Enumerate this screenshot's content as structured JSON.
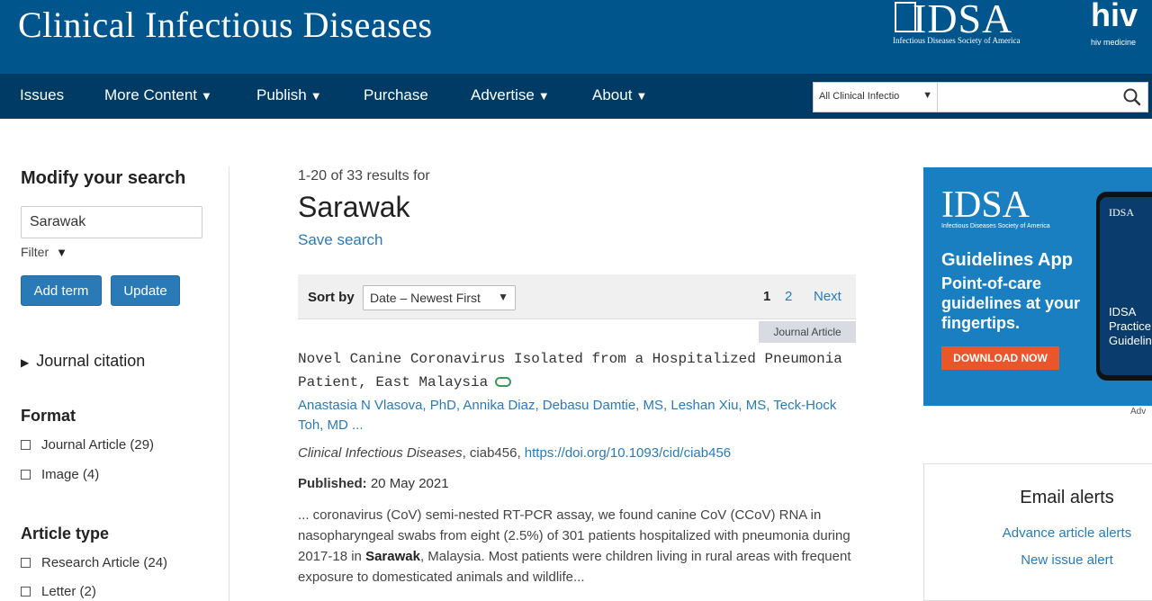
{
  "header": {
    "site_title": "Clinical Infectious Diseases",
    "idsa_logo_text": "IDSA",
    "idsa_logo_sub": "Infectious Diseases Society of America",
    "hivma_logo_text": "hiv",
    "hivma_logo_sub": "hiv medicine"
  },
  "nav": {
    "items": [
      {
        "label": "Issues",
        "dropdown": false
      },
      {
        "label": "More Content",
        "dropdown": true
      },
      {
        "label": "Publish",
        "dropdown": true
      },
      {
        "label": "Purchase",
        "dropdown": false
      },
      {
        "label": "Advertise",
        "dropdown": true
      },
      {
        "label": "About",
        "dropdown": true
      }
    ],
    "search_scope": "All Clinical Infectio",
    "search_value": ""
  },
  "sidebar": {
    "heading": "Modify your search",
    "search_value": "Sarawak",
    "filter_label": "Filter",
    "add_term_label": "Add term",
    "update_label": "Update",
    "journal_citation_label": "Journal citation",
    "facets": [
      {
        "heading": "Format",
        "items": [
          "Journal Article (29)",
          "Image (4)"
        ]
      },
      {
        "heading": "Article type",
        "items": [
          "Research Article (24)",
          "Letter (2)"
        ]
      }
    ]
  },
  "results": {
    "count_text": "1-20 of 33 results for",
    "query": "Sarawak",
    "save_search_label": "Save search",
    "sort_label": "Sort by",
    "sort_value": "Date – Newest First",
    "pages": [
      "1",
      "2"
    ],
    "next_label": "Next",
    "article": {
      "type_tag": "Journal Article",
      "title": "Novel Canine Coronavirus Isolated from a Hospitalized Pneumonia Patient, East Malaysia",
      "authors": "Anastasia N Vlasova, PhD, Annika Diaz, Debasu Damtie, MS, Leshan Xiu, MS, Teck-Hock Toh, MD ...",
      "journal": "Clinical Infectious Diseases",
      "citation_id": ", ciab456,",
      "doi": "https://doi.org/10.1093/cid/ciab456",
      "published_label": "Published:",
      "published_date": "20 May 2021",
      "snippet_before": "... coronavirus (CoV) semi-nested RT-PCR assay, we found canine CoV (CCoV) RNA in nasopharyngeal swabs from eight (2.5%) of 301 patients hospitalized with pneumonia during 2017-18 in ",
      "snippet_bold": "Sarawak",
      "snippet_after": ", Malaysia. Most patients were children living in rural areas with frequent exposure to domesticated animals and wildlife..."
    }
  },
  "ad": {
    "logo_text": "IDSA",
    "logo_sub": "Infectious Diseases Society of America",
    "title": "Guidelines App",
    "body": "Point-of-care guidelines at your fingertips.",
    "button_label": "DOWNLOAD NOW",
    "phone_logo": "IDSA",
    "phone_text": "IDSA Practice Guideline",
    "ad_label": "Adv"
  },
  "alerts": {
    "title": "Email alerts",
    "links": [
      "Advance article alerts",
      "New issue alert"
    ]
  },
  "colors": {
    "header_bg": "#00558c",
    "nav_bg": "#003b66",
    "link": "#2a7ab8",
    "button": "#2a7ab8",
    "ad_bg": "#1a7fc1",
    "ad_button": "#e8562a"
  }
}
